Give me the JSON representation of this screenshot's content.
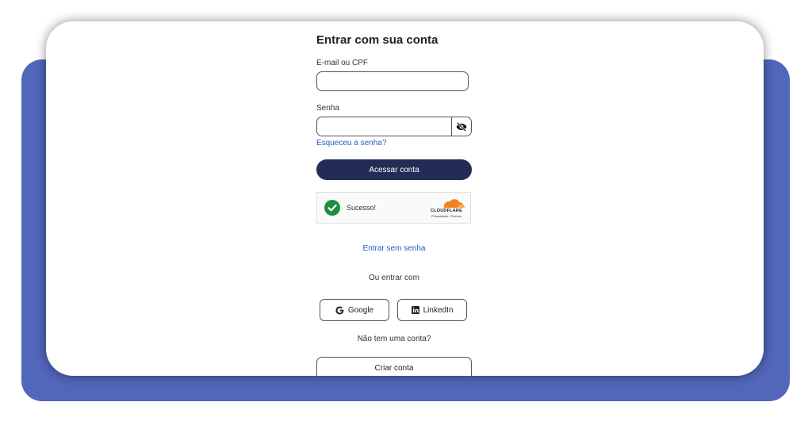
{
  "login": {
    "title": "Entrar com sua conta",
    "email_label": "E-mail ou CPF",
    "email_value": "",
    "password_label": "Senha",
    "password_value": "",
    "forgot_password_link": "Esqueceu a senha?",
    "submit_button": "Acessar conta",
    "passwordless_link": "Entrar sem senha",
    "alt_login_text": "Ou entrar com",
    "social_buttons": [
      {
        "label": "Google",
        "icon": "google-icon"
      },
      {
        "label": "LinkedIn",
        "icon": "linkedin-icon"
      }
    ],
    "no_account_text": "Não tem uma conta?",
    "create_account_button": "Criar conta",
    "password_toggle_icon": "eye-off-icon"
  },
  "captcha": {
    "status_text": "Sucesso!",
    "provider": "CLOUDFLARE",
    "provider_links": "Privacidade • Termos",
    "status_color": "#1e8e3e"
  },
  "colors": {
    "backdrop": "#5266bb",
    "primary_button": "#232c55",
    "link": "#1f5fbf",
    "cloudflare_orange": "#f48120"
  }
}
